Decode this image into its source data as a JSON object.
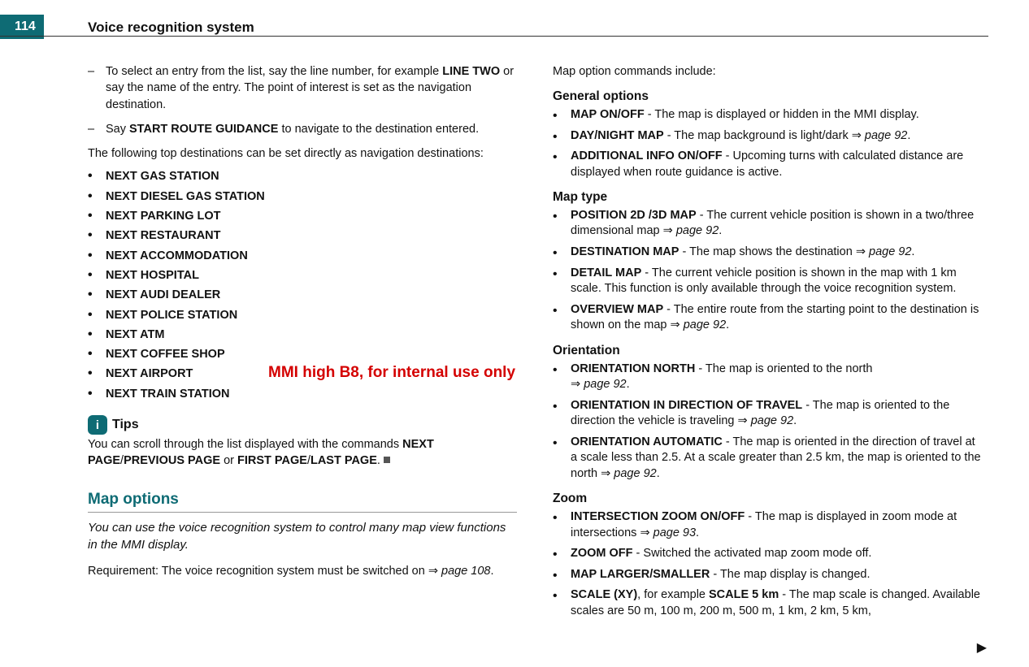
{
  "page_number": "114",
  "chapter_title": "Voice recognition system",
  "watermark": "MMI high B8, for internal use only",
  "left": {
    "dash_items": [
      {
        "prefix": "To select an entry from the list, say the line number, for example ",
        "bold1": "LINE TWO",
        "mid": " or say the name of the entry. The point of interest is set as the navigation destination."
      },
      {
        "prefix": "Say ",
        "bold1": "START ROUTE GUIDANCE",
        "mid": " to navigate to the destination entered."
      }
    ],
    "intro_para": "The following top destinations can be set directly as navigation destinations:",
    "bullets": [
      "NEXT GAS STATION",
      "NEXT DIESEL GAS STATION",
      "NEXT PARKING LOT",
      "NEXT RESTAURANT",
      "NEXT ACCOMMODATION",
      "NEXT HOSPITAL",
      "NEXT AUDI DEALER",
      "NEXT POLICE STATION",
      "NEXT ATM",
      "NEXT COFFEE SHOP",
      "NEXT AIRPORT",
      "NEXT TRAIN STATION"
    ],
    "tips_label": "Tips",
    "tips_text_a": "You can scroll through the list displayed with the commands ",
    "tips_bold_a": "NEXT PAGE",
    "tips_sep_a": "/",
    "tips_bold_b": "PREVIOUS PAGE",
    "tips_text_b": " or ",
    "tips_bold_c": "FIRST PAGE",
    "tips_sep_b": "/",
    "tips_bold_d": "LAST PAGE",
    "tips_text_c": ".",
    "map_options_heading": "Map options",
    "map_options_intro": "You can use the voice recognition system to control many map view functions in the MMI display.",
    "requirement_a": "Requirement: The voice recognition system must be switched on ",
    "requirement_ref": "page 108",
    "requirement_b": "."
  },
  "right": {
    "intro": "Map option commands include:",
    "general_heading": "General options",
    "general_items": [
      {
        "b": "MAP ON/OFF",
        "t": " - The map is displayed or hidden in the MMI display."
      },
      {
        "b": "DAY/NIGHT MAP",
        "t": " - The map background is light/dark ",
        "ref": "page 92",
        "tail": "."
      },
      {
        "b": "ADDITIONAL INFO ON/OFF",
        "t": " - Upcoming turns with calculated distance are displayed when route guidance is active."
      }
    ],
    "maptype_heading": "Map type",
    "maptype_items": [
      {
        "b": "POSITION 2D /3D MAP",
        "t": " - The current vehicle position is shown in a two/three dimensional map ",
        "ref": "page 92",
        "tail": "."
      },
      {
        "b": "DESTINATION MAP",
        "t": " - The map shows the destination ",
        "ref": "page 92",
        "tail": "."
      },
      {
        "b": "DETAIL MAP",
        "t": " - The current vehicle position is shown in the map with 1 km scale. This function is only available through the voice recognition system."
      },
      {
        "b": "OVERVIEW MAP",
        "t": " - The entire route from the starting point to the destination is shown on the map ",
        "ref": "page 92",
        "tail": "."
      }
    ],
    "orientation_heading": "Orientation",
    "orientation_items": [
      {
        "b": "ORIENTATION NORTH",
        "t": " - The map is oriented to the north ",
        "ref": "page 92",
        "tail": "."
      },
      {
        "b": "ORIENTATION IN DIRECTION OF TRAVEL",
        "t": " - The map is oriented to the direction the vehicle is traveling ",
        "ref": "page 92",
        "tail": "."
      },
      {
        "b": "ORIENTATION AUTOMATIC",
        "t": " - The map is oriented in the direction of travel at a scale less than 2.5. At a scale greater than 2.5 km, the map is oriented to the north ",
        "ref": "page 92",
        "tail": "."
      }
    ],
    "zoom_heading": "Zoom",
    "zoom_items": [
      {
        "b": "INTERSECTION ZOOM ON/OFF",
        "t": " - The map is displayed in zoom mode at intersections ",
        "ref": "page 93",
        "tail": "."
      },
      {
        "b": "ZOOM OFF",
        "t": " - Switched the activated map zoom mode off."
      },
      {
        "b": "MAP LARGER/SMALLER",
        "t": " - The map display is changed."
      },
      {
        "b": "SCALE (XY)",
        "t": ", for example ",
        "b2": "SCALE 5 km",
        "t2": " - The map scale is changed. Available scales are 50 m, 100 m, 200 m, 500 m, 1 km, 2 km, 5 km,"
      }
    ]
  },
  "arrow_glyph": "⇒",
  "cont_glyph": "▶"
}
